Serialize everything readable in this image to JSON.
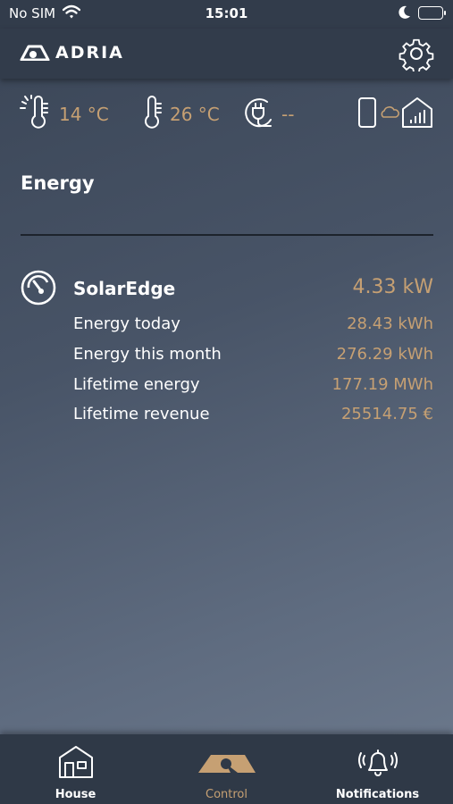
{
  "status_bar": {
    "carrier": "No SIM",
    "time": "15:01"
  },
  "header": {
    "logo_text": "ADRIA",
    "settings_icon": "gear-icon"
  },
  "environment": {
    "outdoor_temp": "14 °C",
    "indoor_temp": "26 °C",
    "power_status": "--",
    "outdoor_icon": "sun-thermometer-icon",
    "indoor_icon": "thermometer-icon",
    "power_icon": "plug-icon",
    "connectivity_icons": [
      "phone-icon",
      "cloud-icon",
      "house-signal-icon"
    ]
  },
  "section": {
    "title": "Energy"
  },
  "device": {
    "name": "SolarEdge",
    "current_power": "4.33 kW",
    "rows": [
      {
        "label": "Energy today",
        "value": "28.43 kWh"
      },
      {
        "label": "Energy this month",
        "value": "276.29 kWh"
      },
      {
        "label": "Lifetime energy",
        "value": "177.19 MWh"
      },
      {
        "label": "Lifetime revenue",
        "value": "25514.75 €"
      }
    ]
  },
  "tabs": [
    {
      "label": "House",
      "icon": "house-icon",
      "active": false
    },
    {
      "label": "Control",
      "icon": "adria-logo-icon",
      "active": true
    },
    {
      "label": "Notifications",
      "icon": "bell-icon",
      "active": false
    }
  ],
  "colors": {
    "accent": "#c6a073",
    "background": "#485467",
    "bar": "#323c4b"
  }
}
